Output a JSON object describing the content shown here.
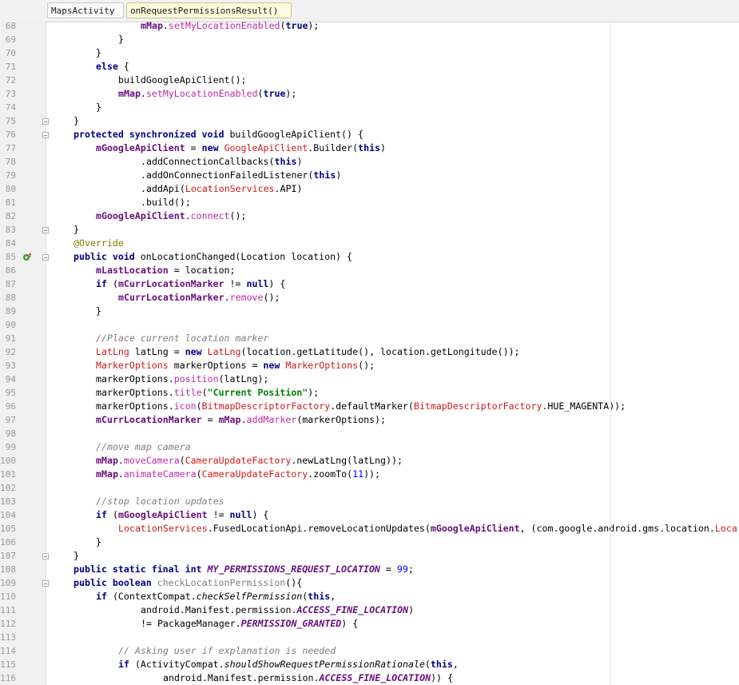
{
  "breadcrumb": {
    "class_name": "MapsActivity",
    "method_name": "onRequestPermissionsResult()"
  },
  "gutter": {
    "override_marker_icon": "override-method-icon"
  },
  "colors": {
    "keyword": "#000080",
    "field": "#660e7a",
    "class_ref": "#cc1b1b",
    "method_call": "#bb2aa6",
    "string": "#008000",
    "comment": "#808080",
    "number": "#0000ff",
    "annotation": "#808000"
  },
  "code_lines": [
    {
      "n": "68",
      "indent": 3,
      "tokens": [
        [
          "fld",
          "mMap"
        ],
        [
          "plain",
          "."
        ],
        [
          "mth",
          "setMyLocationEnabled"
        ],
        [
          "plain",
          "("
        ],
        [
          "kw",
          "true"
        ],
        [
          "plain",
          ");"
        ]
      ]
    },
    {
      "n": "69",
      "indent": 2,
      "tokens": [
        [
          "plain",
          "}"
        ]
      ]
    },
    {
      "n": "70",
      "indent": 1,
      "tokens": [
        [
          "plain",
          "}"
        ]
      ]
    },
    {
      "n": "71",
      "indent": 1,
      "tokens": [
        [
          "kw",
          "else"
        ],
        [
          "plain",
          " {"
        ]
      ]
    },
    {
      "n": "72",
      "indent": 2,
      "tokens": [
        [
          "plain",
          "buildGoogleApiClient();"
        ]
      ]
    },
    {
      "n": "73",
      "indent": 2,
      "tokens": [
        [
          "fld",
          "mMap"
        ],
        [
          "plain",
          "."
        ],
        [
          "mth",
          "setMyLocationEnabled"
        ],
        [
          "plain",
          "("
        ],
        [
          "kw",
          "true"
        ],
        [
          "plain",
          ");"
        ]
      ]
    },
    {
      "n": "74",
      "indent": 1,
      "tokens": [
        [
          "plain",
          "}"
        ]
      ]
    },
    {
      "n": "75",
      "indent": 0,
      "tokens": [
        [
          "plain",
          "}"
        ]
      ]
    },
    {
      "n": "76",
      "indent": 0,
      "tokens": [
        [
          "kw",
          "protected synchronized void"
        ],
        [
          "plain",
          " buildGoogleApiClient() {"
        ]
      ]
    },
    {
      "n": "77",
      "indent": 1,
      "tokens": [
        [
          "fld",
          "mGoogleApiClient"
        ],
        [
          "plain",
          " = "
        ],
        [
          "kw",
          "new"
        ],
        [
          "plain",
          " "
        ],
        [
          "cls",
          "GoogleApiClient"
        ],
        [
          "plain",
          ".Builder("
        ],
        [
          "kw",
          "this"
        ],
        [
          "plain",
          ")"
        ]
      ]
    },
    {
      "n": "78",
      "indent": 3,
      "tokens": [
        [
          "plain",
          ".addConnectionCallbacks("
        ],
        [
          "kw",
          "this"
        ],
        [
          "plain",
          ")"
        ]
      ]
    },
    {
      "n": "79",
      "indent": 3,
      "tokens": [
        [
          "plain",
          ".addOnConnectionFailedListener("
        ],
        [
          "kw",
          "this"
        ],
        [
          "plain",
          ")"
        ]
      ]
    },
    {
      "n": "80",
      "indent": 3,
      "tokens": [
        [
          "plain",
          ".addApi("
        ],
        [
          "cls",
          "LocationServices"
        ],
        [
          "plain",
          ".API)"
        ]
      ]
    },
    {
      "n": "81",
      "indent": 3,
      "tokens": [
        [
          "plain",
          ".build();"
        ]
      ]
    },
    {
      "n": "82",
      "indent": 1,
      "tokens": [
        [
          "fld",
          "mGoogleApiClient"
        ],
        [
          "plain",
          "."
        ],
        [
          "mth",
          "connect"
        ],
        [
          "plain",
          "();"
        ]
      ]
    },
    {
      "n": "83",
      "indent": 0,
      "tokens": [
        [
          "plain",
          "}"
        ]
      ]
    },
    {
      "n": "84",
      "indent": 0,
      "tokens": [
        [
          "ann",
          "@Override"
        ]
      ]
    },
    {
      "n": "85",
      "indent": 0,
      "tokens": [
        [
          "kw",
          "public void"
        ],
        [
          "plain",
          " onLocationChanged(Location location) {"
        ]
      ]
    },
    {
      "n": "86",
      "indent": 1,
      "tokens": [
        [
          "fld",
          "mLastLocation"
        ],
        [
          "plain",
          " = location;"
        ]
      ]
    },
    {
      "n": "87",
      "indent": 1,
      "tokens": [
        [
          "kw",
          "if"
        ],
        [
          "plain",
          " ("
        ],
        [
          "fld",
          "mCurrLocationMarker"
        ],
        [
          "plain",
          " != "
        ],
        [
          "kw",
          "null"
        ],
        [
          "plain",
          ") {"
        ]
      ]
    },
    {
      "n": "88",
      "indent": 2,
      "tokens": [
        [
          "fld",
          "mCurrLocationMarker"
        ],
        [
          "plain",
          "."
        ],
        [
          "mth",
          "remove"
        ],
        [
          "plain",
          "();"
        ]
      ]
    },
    {
      "n": "89",
      "indent": 1,
      "tokens": [
        [
          "plain",
          "}"
        ]
      ]
    },
    {
      "n": "90",
      "indent": 0,
      "tokens": []
    },
    {
      "n": "91",
      "indent": 1,
      "tokens": [
        [
          "cmt",
          "//Place current location marker"
        ]
      ]
    },
    {
      "n": "92",
      "indent": 1,
      "tokens": [
        [
          "cls",
          "LatLng"
        ],
        [
          "plain",
          " latLng = "
        ],
        [
          "kw",
          "new"
        ],
        [
          "plain",
          " "
        ],
        [
          "cls",
          "LatLng"
        ],
        [
          "plain",
          "(location.getLatitude(), location.getLongitude());"
        ]
      ]
    },
    {
      "n": "93",
      "indent": 1,
      "tokens": [
        [
          "cls",
          "MarkerOptions"
        ],
        [
          "plain",
          " markerOptions = "
        ],
        [
          "kw",
          "new"
        ],
        [
          "plain",
          " "
        ],
        [
          "cls",
          "MarkerOptions"
        ],
        [
          "plain",
          "();"
        ]
      ]
    },
    {
      "n": "94",
      "indent": 1,
      "tokens": [
        [
          "plain",
          "markerOptions."
        ],
        [
          "mth",
          "position"
        ],
        [
          "plain",
          "(latLng);"
        ]
      ]
    },
    {
      "n": "95",
      "indent": 1,
      "tokens": [
        [
          "plain",
          "markerOptions."
        ],
        [
          "mth",
          "title"
        ],
        [
          "plain",
          "("
        ],
        [
          "str",
          "\"Current Position\""
        ],
        [
          "plain",
          ");"
        ]
      ]
    },
    {
      "n": "96",
      "indent": 1,
      "tokens": [
        [
          "plain",
          "markerOptions."
        ],
        [
          "mth",
          "icon"
        ],
        [
          "plain",
          "("
        ],
        [
          "cls",
          "BitmapDescriptorFactory"
        ],
        [
          "plain",
          ".defaultMarker("
        ],
        [
          "cls",
          "BitmapDescriptorFactory"
        ],
        [
          "plain",
          ".HUE_MAGENTA));"
        ]
      ]
    },
    {
      "n": "97",
      "indent": 1,
      "tokens": [
        [
          "fld",
          "mCurrLocationMarker"
        ],
        [
          "plain",
          " = "
        ],
        [
          "fld",
          "mMap"
        ],
        [
          "plain",
          "."
        ],
        [
          "mth",
          "addMarker"
        ],
        [
          "plain",
          "(markerOptions);"
        ]
      ]
    },
    {
      "n": "98",
      "indent": 0,
      "tokens": []
    },
    {
      "n": "99",
      "indent": 1,
      "tokens": [
        [
          "cmt",
          "//move map camera"
        ]
      ]
    },
    {
      "n": "100",
      "indent": 1,
      "tokens": [
        [
          "fld",
          "mMap"
        ],
        [
          "plain",
          "."
        ],
        [
          "mth",
          "moveCamera"
        ],
        [
          "plain",
          "("
        ],
        [
          "cls",
          "CameraUpdateFactory"
        ],
        [
          "plain",
          ".newLatLng(latLng));"
        ]
      ]
    },
    {
      "n": "101",
      "indent": 1,
      "tokens": [
        [
          "fld",
          "mMap"
        ],
        [
          "plain",
          "."
        ],
        [
          "mth",
          "animateCamera"
        ],
        [
          "plain",
          "("
        ],
        [
          "cls",
          "CameraUpdateFactory"
        ],
        [
          "plain",
          ".zoomTo("
        ],
        [
          "num",
          "11"
        ],
        [
          "plain",
          "));"
        ]
      ]
    },
    {
      "n": "102",
      "indent": 0,
      "tokens": []
    },
    {
      "n": "103",
      "indent": 1,
      "tokens": [
        [
          "cmt",
          "//stop location updates"
        ]
      ]
    },
    {
      "n": "104",
      "indent": 1,
      "tokens": [
        [
          "kw",
          "if"
        ],
        [
          "plain",
          " ("
        ],
        [
          "fld",
          "mGoogleApiClient"
        ],
        [
          "plain",
          " != "
        ],
        [
          "kw",
          "null"
        ],
        [
          "plain",
          ") {"
        ]
      ]
    },
    {
      "n": "105",
      "indent": 2,
      "tokens": [
        [
          "cls",
          "LocationServices"
        ],
        [
          "plain",
          ".FusedLocationApi.removeLocationUpdates("
        ],
        [
          "fld",
          "mGoogleApiClient"
        ],
        [
          "plain",
          ", (com.google.android.gms.location."
        ],
        [
          "cls",
          "Loca"
        ]
      ]
    },
    {
      "n": "106",
      "indent": 1,
      "tokens": [
        [
          "plain",
          "}"
        ]
      ]
    },
    {
      "n": "107",
      "indent": 0,
      "tokens": [
        [
          "plain",
          "}"
        ]
      ]
    },
    {
      "n": "108",
      "indent": 0,
      "tokens": [
        [
          "kw",
          "public static final int"
        ],
        [
          "plain",
          " "
        ],
        [
          "sfld",
          "MY_PERMISSIONS_REQUEST_LOCATION"
        ],
        [
          "plain",
          " = "
        ],
        [
          "num",
          "99"
        ],
        [
          "plain",
          ";"
        ]
      ]
    },
    {
      "n": "109",
      "indent": 0,
      "tokens": [
        [
          "kw",
          "public boolean"
        ],
        [
          "plain",
          " "
        ],
        [
          "gray",
          "checkLocationPermission"
        ],
        [
          "plain",
          "(){"
        ]
      ]
    },
    {
      "n": "110",
      "indent": 1,
      "tokens": [
        [
          "kw",
          "if"
        ],
        [
          "plain",
          " (ContextCompat."
        ],
        [
          "smth",
          "checkSelfPermission"
        ],
        [
          "plain",
          "("
        ],
        [
          "kw",
          "this"
        ],
        [
          "plain",
          ","
        ]
      ]
    },
    {
      "n": "111",
      "indent": 3,
      "tokens": [
        [
          "plain",
          "android.Manifest.permission."
        ],
        [
          "sfld",
          "ACCESS_FINE_LOCATION"
        ],
        [
          "plain",
          ")"
        ]
      ]
    },
    {
      "n": "112",
      "indent": 3,
      "tokens": [
        [
          "plain",
          "!= PackageManager."
        ],
        [
          "sfld",
          "PERMISSION_GRANTED"
        ],
        [
          "plain",
          ") {"
        ]
      ]
    },
    {
      "n": "113",
      "indent": 0,
      "tokens": []
    },
    {
      "n": "114",
      "indent": 2,
      "tokens": [
        [
          "cmt",
          "// Asking user if explanation is needed"
        ]
      ]
    },
    {
      "n": "115",
      "indent": 2,
      "tokens": [
        [
          "kw",
          "if"
        ],
        [
          "plain",
          " (ActivityCompat."
        ],
        [
          "smth",
          "shouldShowRequestPermissionRationale"
        ],
        [
          "plain",
          "("
        ],
        [
          "kw",
          "this"
        ],
        [
          "plain",
          ","
        ]
      ]
    },
    {
      "n": "116",
      "indent": 4,
      "tokens": [
        [
          "plain",
          "android.Manifest.permission."
        ],
        [
          "sfld",
          "ACCESS_FINE_LOCATION"
        ],
        [
          "plain",
          ")) {"
        ]
      ]
    }
  ]
}
